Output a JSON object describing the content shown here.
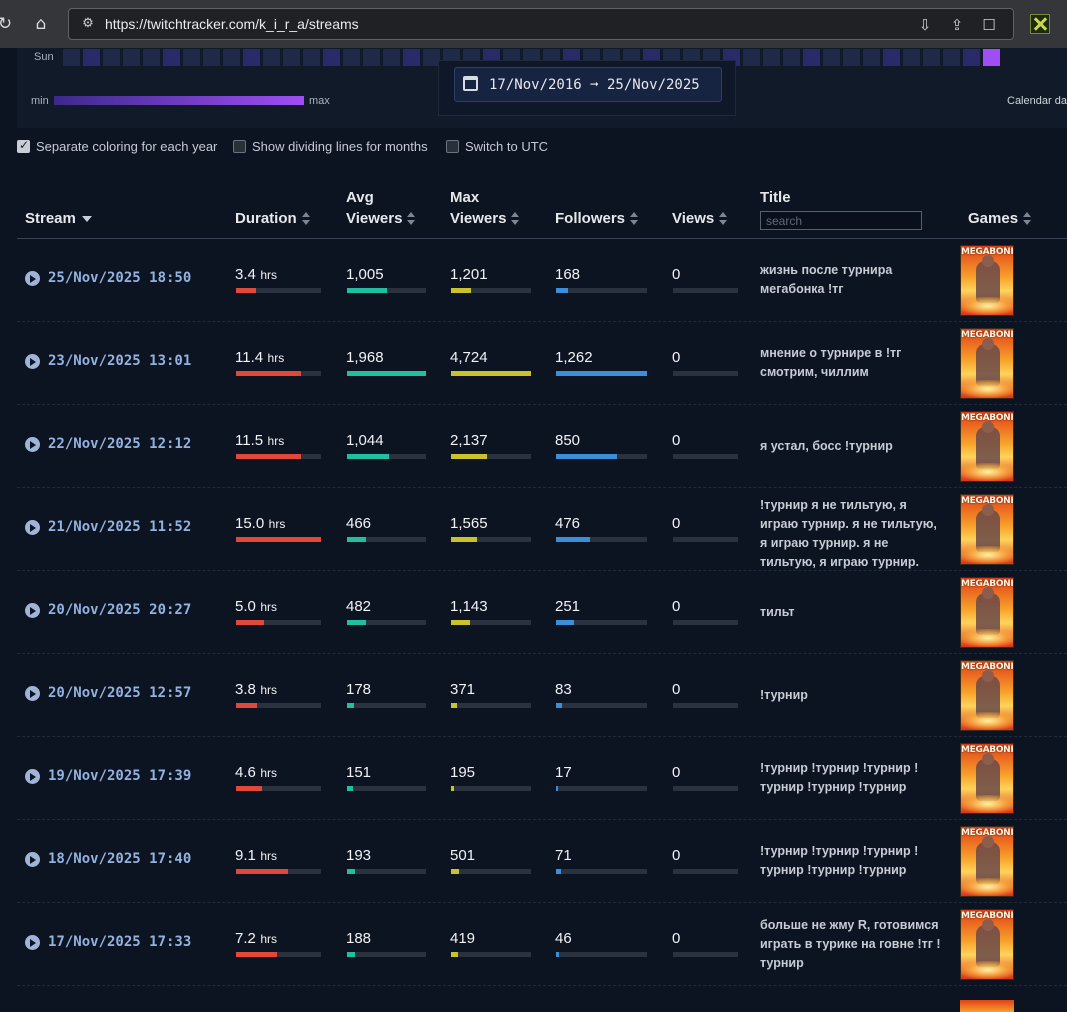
{
  "browser": {
    "url": "https://twitchtracker.com/k_i_r_a/streams"
  },
  "heatmap": {
    "day_label": "Sun",
    "legend_min": "min",
    "legend_max": "max",
    "side_label": "Calendar dat",
    "range_text": "17/Nov/2016 ➞ 25/Nov/2025"
  },
  "options": [
    {
      "label": "Separate coloring for each year",
      "checked": true
    },
    {
      "label": "Show dividing lines for months",
      "checked": false
    },
    {
      "label": "Switch to UTC",
      "checked": false
    }
  ],
  "table": {
    "headers": {
      "stream": "Stream",
      "duration": "Duration",
      "avg1": "Avg",
      "avg2": "Viewers",
      "max1": "Max",
      "max2": "Viewers",
      "followers": "Followers",
      "views": "Views",
      "title": "Title",
      "games": "Games"
    },
    "search_placeholder": "search",
    "game_name": "MEGABONK",
    "unit_hrs": "hrs",
    "colors": {
      "duration": "#e2483a",
      "avg": "#1fbf9f",
      "max": "#c9c22b",
      "followers": "#3b8fd8"
    },
    "rows": [
      {
        "date": "25/Nov/2025 18:50",
        "duration": "3.4",
        "avg": "1,005",
        "max": "1,201",
        "followers": "168",
        "views": "0",
        "title": "жизнь после турнира мегабонка !тг",
        "frac": [
          0.23,
          0.51,
          0.25,
          0.13,
          0
        ]
      },
      {
        "date": "23/Nov/2025 13:01",
        "duration": "11.4",
        "avg": "1,968",
        "max": "4,724",
        "followers": "1,262",
        "views": "0",
        "title": "мнение о турнире в !тг смотрим, чиллим",
        "frac": [
          0.76,
          1.0,
          1.0,
          1.0,
          0
        ]
      },
      {
        "date": "22/Nov/2025 12:12",
        "duration": "11.5",
        "avg": "1,044",
        "max": "2,137",
        "followers": "850",
        "views": "0",
        "title": "я устал, босс !турнир",
        "frac": [
          0.77,
          0.53,
          0.45,
          0.67,
          0
        ]
      },
      {
        "date": "21/Nov/2025 11:52",
        "duration": "15.0",
        "avg": "466",
        "max": "1,565",
        "followers": "476",
        "views": "0",
        "title": "!турнир я не тильтую, я играю турнир. я не тильтую, я играю турнир. я не тильтую, я играю турнир.",
        "frac": [
          1.0,
          0.24,
          0.33,
          0.37,
          0
        ]
      },
      {
        "date": "20/Nov/2025 20:27",
        "duration": "5.0",
        "avg": "482",
        "max": "1,143",
        "followers": "251",
        "views": "0",
        "title": "тильт",
        "frac": [
          0.33,
          0.24,
          0.24,
          0.2,
          0
        ]
      },
      {
        "date": "20/Nov/2025 12:57",
        "duration": "3.8",
        "avg": "178",
        "max": "371",
        "followers": "83",
        "views": "0",
        "title": "!турнир",
        "frac": [
          0.25,
          0.09,
          0.08,
          0.066,
          0
        ]
      },
      {
        "date": "19/Nov/2025 17:39",
        "duration": "4.6",
        "avg": "151",
        "max": "195",
        "followers": "17",
        "views": "0",
        "title": "!турнир !турнир !турнир ! турнир !турнир !турнир",
        "frac": [
          0.31,
          0.077,
          0.041,
          0.013,
          0
        ]
      },
      {
        "date": "18/Nov/2025 17:40",
        "duration": "9.1",
        "avg": "193",
        "max": "501",
        "followers": "71",
        "views": "0",
        "title": "!турнир !турнир !турнир ! турнир !турнир !турнир",
        "frac": [
          0.61,
          0.098,
          0.106,
          0.056,
          0
        ]
      },
      {
        "date": "17/Nov/2025 17:33",
        "duration": "7.2",
        "avg": "188",
        "max": "419",
        "followers": "46",
        "views": "0",
        "title": "больше не жму R, готовимся играть в турике на говне !тг ! турнир",
        "frac": [
          0.48,
          0.096,
          0.089,
          0.036,
          0
        ]
      }
    ]
  }
}
